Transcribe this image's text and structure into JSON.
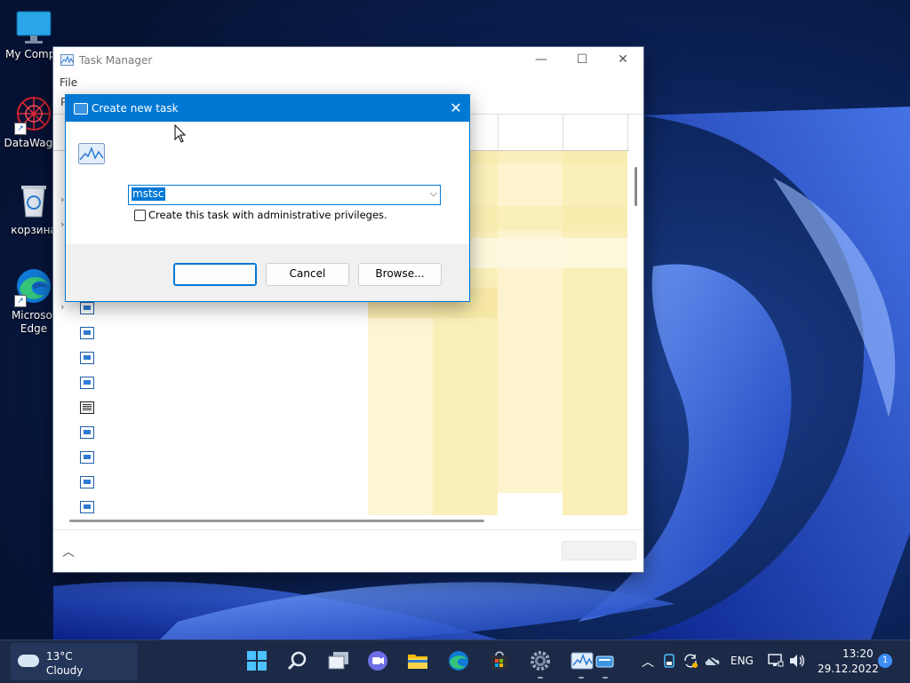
{
  "desktop": {
    "icons": [
      {
        "label": "My Compu",
        "icon": "monitor-icon"
      },
      {
        "label": "DataWagor",
        "icon": "datawagon-icon"
      },
      {
        "label": "корзина",
        "icon": "recycle-bin-icon"
      },
      {
        "label": "Microsof\nEdge",
        "icon": "edge-icon"
      }
    ]
  },
  "task_manager": {
    "title": "Task Manager",
    "menu": {
      "file": "File"
    },
    "tab_first_letter": "P",
    "colors": {
      "heat_light": "#fdf5d3",
      "heat_mid": "#fbefb9",
      "heat_strong": "#f8e9a8"
    }
  },
  "dialog": {
    "title": "Create new task",
    "open_label": "",
    "open_value": "mstsc",
    "admin_checkbox_label": "Create this task with administrative privileges.",
    "admin_checked": false,
    "ok_label": "",
    "cancel_label": "Cancel",
    "browse_label": "Browse..."
  },
  "taskbar": {
    "weather": {
      "temp": "13°C",
      "condition": "Cloudy"
    },
    "apps": [
      "start-icon",
      "search-icon",
      "task-view-icon",
      "chat-icon",
      "file-explorer-icon",
      "edge-icon",
      "store-icon",
      "settings-icon",
      "task-manager-icon"
    ],
    "tray": {
      "language": "ENG"
    },
    "clock": {
      "time": "13:20",
      "date": "29.12.2022"
    },
    "notification_count": "1",
    "accent": "#0078d4"
  }
}
